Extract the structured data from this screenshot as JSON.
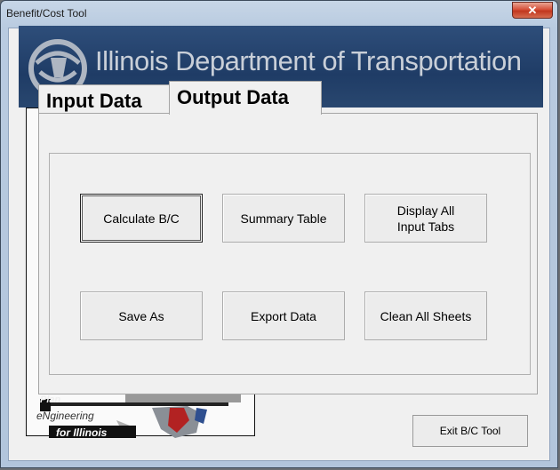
{
  "window": {
    "title": "Benefit/Cost Tool"
  },
  "banner": {
    "agency": "Illinois Department of Transportation"
  },
  "tabs": [
    {
      "label": "Input Data",
      "selected": false
    },
    {
      "label": "Output Data",
      "selected": true
    }
  ],
  "buttons": {
    "calculate": "Calculate B/C",
    "summary": "Summary Table",
    "display_all_line1": "Display All",
    "display_all_line2": "Input Tabs",
    "save_as": "Save As",
    "export": "Export Data",
    "clean": "Clean All Sheets",
    "exit": "Exit B/C Tool"
  },
  "underform": {
    "logo_line1": "Plan",
    "logo_line2": "eNgineering",
    "logo_line3": "for Illinois"
  },
  "colors": {
    "banner": "#1f3c66",
    "close_button": "#c1371f"
  }
}
